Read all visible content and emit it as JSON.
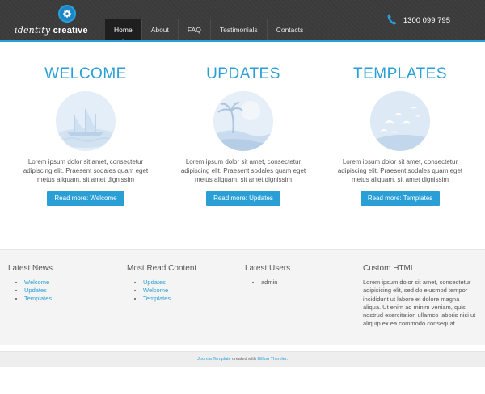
{
  "brand": {
    "logo_text_light": "identity",
    "logo_text_bold": "creative"
  },
  "nav": {
    "items": [
      {
        "label": "Home",
        "active": true
      },
      {
        "label": "About",
        "active": false
      },
      {
        "label": "FAQ",
        "active": false
      },
      {
        "label": "Testimonials",
        "active": false
      },
      {
        "label": "Contacts",
        "active": false
      }
    ]
  },
  "contact": {
    "phone": "1300 099 795",
    "icon": "phone-icon"
  },
  "features": [
    {
      "title": "WELCOME",
      "image": "boat-image",
      "text": "Lorem ipsum dolor sit amet, consectetur adipiscing elit. Praesent sodales quam eget metus aliquam, sit amet dignissim",
      "button": "Read more: Welcome"
    },
    {
      "title": "UPDATES",
      "image": "palm-island-image",
      "text": "Lorem ipsum dolor sit amet, consectetur adipiscing elit. Praesent sodales quam eget metus aliquam, sit amet dignissim",
      "button": "Read more: Updates"
    },
    {
      "title": "TEMPLATES",
      "image": "birds-image",
      "text": "Lorem ipsum dolor sit amet, consectetur adipiscing elit. Praesent sodales quam eget metus aliquam, sit amet dignissim",
      "button": "Read more: Templates"
    }
  ],
  "modules": {
    "latest_news": {
      "title": "Latest News",
      "items": [
        "Welcome",
        "Updates",
        "Templates"
      ]
    },
    "most_read": {
      "title": "Most Read Content",
      "items": [
        "Updates",
        "Welcome",
        "Templates"
      ]
    },
    "latest_users": {
      "title": "Latest Users",
      "items": [
        "admin"
      ]
    },
    "custom_html": {
      "title": "Custom HTML",
      "text": "Lorem ipsum dolor sit amet, consectetur adipisicing elit, sed do eiusmod tempor incididunt ut labore et dolore magna aliqua. Ut enim ad minim veniam, quis nostrud exercitation ullamco laboris nisi ut aliquip ex ea commodo consequat."
    }
  },
  "footer": {
    "link1": "Joomla Template",
    "middle": " created with ",
    "link2": "Billion Themler",
    "end": "."
  },
  "colors": {
    "accent": "#2a9fd6",
    "header_bg": "#3a3a3a",
    "module_bg": "#f4f4f4"
  }
}
